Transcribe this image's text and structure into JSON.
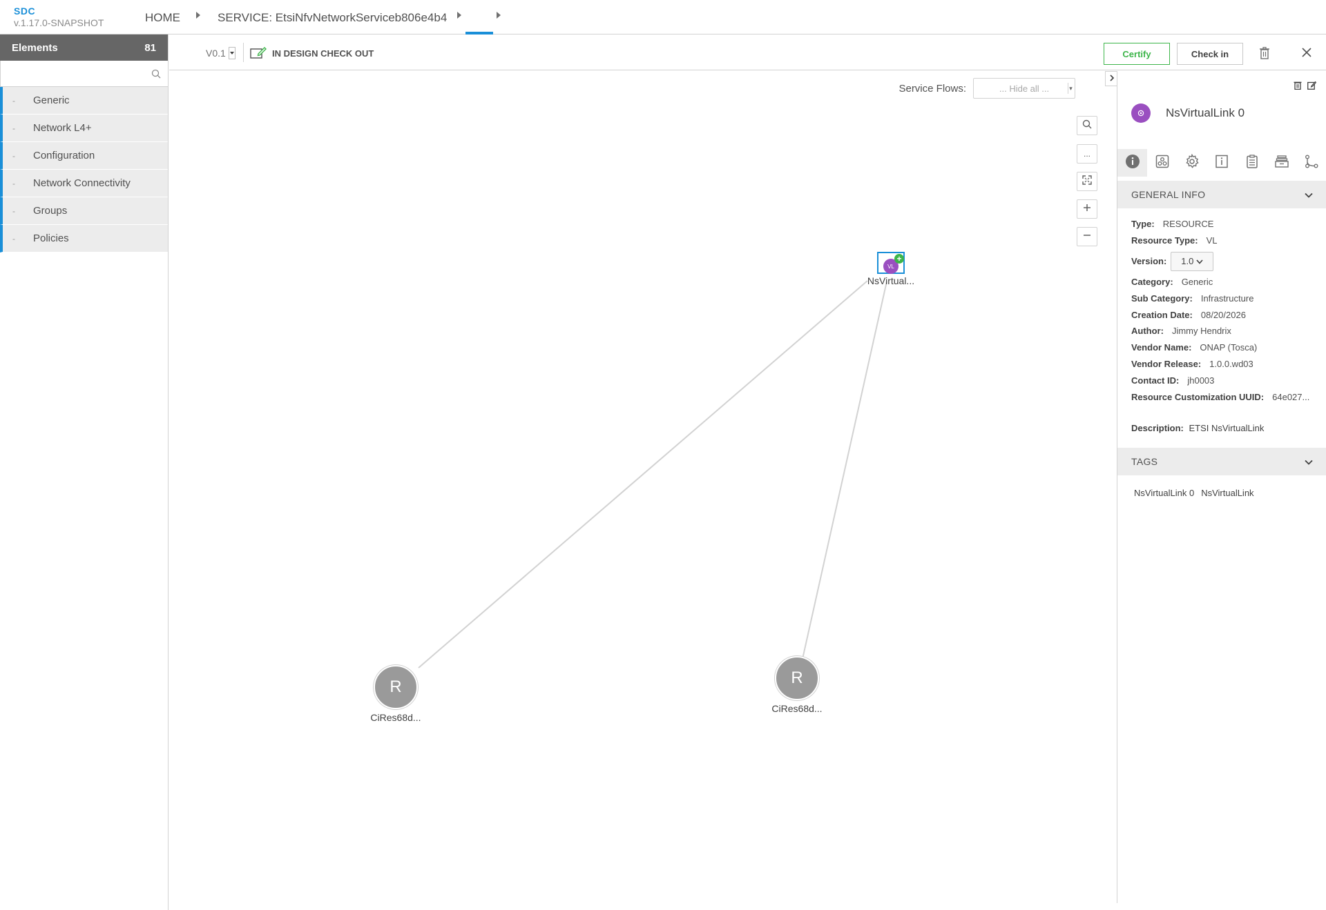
{
  "app": {
    "name": "SDC",
    "version": "v.1.17.0-SNAPSHOT"
  },
  "breadcrumb": {
    "home": "HOME",
    "service": "SERVICE: EtsiNfvNetworkServiceb806e4b4",
    "current": ""
  },
  "palette": {
    "header": "Elements",
    "count": "81",
    "search_placeholder": "",
    "categories": [
      {
        "dash": "-",
        "label": "Generic"
      },
      {
        "dash": "-",
        "label": "Network L4+"
      },
      {
        "dash": "-",
        "label": "Configuration"
      },
      {
        "dash": "-",
        "label": "Network Connectivity"
      },
      {
        "dash": "-",
        "label": "Groups"
      },
      {
        "dash": "-",
        "label": "Policies"
      }
    ]
  },
  "toolbar": {
    "version": "V0.1",
    "status": "IN DESIGN CHECK OUT",
    "certify_label": "Certify",
    "checkin_label": "Check in"
  },
  "canvas": {
    "service_flows_label": "Service Flows:",
    "service_flows_value": "... Hide all ...",
    "more_label": "...",
    "nodes": [
      {
        "label": "NsVirtual...",
        "icon_text": "VL"
      },
      {
        "label": "CiRes68d...",
        "icon_text": "R"
      },
      {
        "label": "CiRes68d...",
        "icon_text": "R"
      }
    ]
  },
  "details": {
    "name": "NsVirtualLink 0",
    "general_info_header": "GENERAL INFO",
    "fields": {
      "type": {
        "key": "Type:",
        "value": "RESOURCE"
      },
      "resource_type": {
        "key": "Resource Type:",
        "value": "VL"
      },
      "version": {
        "key": "Version:",
        "value": "1.0"
      },
      "category": {
        "key": "Category:",
        "value": "Generic"
      },
      "sub_category": {
        "key": "Sub Category:",
        "value": "Infrastructure"
      },
      "creation_date": {
        "key": "Creation Date:",
        "value": "08/20/2026"
      },
      "author": {
        "key": "Author:",
        "value": "Jimmy Hendrix"
      },
      "vendor_name": {
        "key": "Vendor Name:",
        "value": "ONAP (Tosca)"
      },
      "vendor_release": {
        "key": "Vendor Release:",
        "value": "1.0.0.wd03"
      },
      "contact_id": {
        "key": "Contact ID:",
        "value": "jh0003"
      },
      "customization_uuid": {
        "key": "Resource Customization UUID:",
        "value": "64e027..."
      }
    },
    "description": {
      "key": "Description:",
      "value": "ETSI NsVirtualLink"
    },
    "tags_header": "TAGS",
    "tags": [
      "NsVirtualLink 0",
      "NsVirtualLink"
    ]
  },
  "colors": {
    "accent": "#1a8fd8",
    "certify": "#3db54a",
    "vl_icon": "#9a4fc0",
    "resource_node": "#9a9a9a",
    "palette_header": "#666666"
  }
}
